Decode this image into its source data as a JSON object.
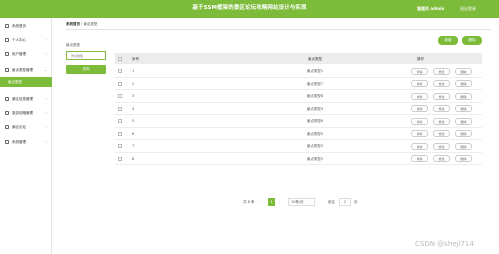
{
  "header": {
    "title": "基于SSM框架的景区论坛攻略网站设计与实现",
    "user": "管理员 admin",
    "exit": "退出登录"
  },
  "sidebar": {
    "items": [
      {
        "label": "系统首页",
        "arrow": ""
      },
      {
        "label": "个人中心",
        "arrow": "›"
      },
      {
        "label": "用户管理",
        "arrow": "›"
      },
      {
        "label": "景点类型管理",
        "arrow": "⌄"
      },
      {
        "label": "景区信息管理",
        "arrow": "›"
      },
      {
        "label": "旅游攻略管理",
        "arrow": "›"
      },
      {
        "label": "景区论坛",
        "arrow": "›"
      },
      {
        "label": "系统管理",
        "arrow": "›"
      }
    ],
    "active_sub": "景点类型"
  },
  "breadcrumb": {
    "home": "系统首页",
    "sep": "/",
    "current": "景点类型"
  },
  "filter": {
    "label": "景点类型",
    "placeholder": "景点类型",
    "search_label": "查询"
  },
  "toolbar": {
    "add_label": "新增",
    "delete_label": "删除"
  },
  "table": {
    "headers": {
      "no": "序号",
      "name": "景点类型",
      "op": "操作"
    },
    "op_labels": {
      "detail": "详情",
      "edit": "修改",
      "delete": "删除"
    },
    "rows": [
      {
        "no": "1",
        "name": "景点类型1"
      },
      {
        "no": "2",
        "name": "景点类型7"
      },
      {
        "no": "3",
        "name": "景点类型8"
      },
      {
        "no": "4",
        "name": "景点类型4"
      },
      {
        "no": "5",
        "name": "景点类型6"
      },
      {
        "no": "6",
        "name": "景点类型5"
      },
      {
        "no": "7",
        "name": "景点类型3"
      },
      {
        "no": "8",
        "name": "景点类型2"
      }
    ]
  },
  "pagination": {
    "total": "共 8 条",
    "prev": "‹",
    "current": "1",
    "next": "›",
    "page_size": "10条/页",
    "goto_label": "前往",
    "goto_value": "1",
    "page_suffix": "页"
  },
  "watermark": "CSDN @sheji714",
  "colors": {
    "accent": "#7dbb3a"
  }
}
